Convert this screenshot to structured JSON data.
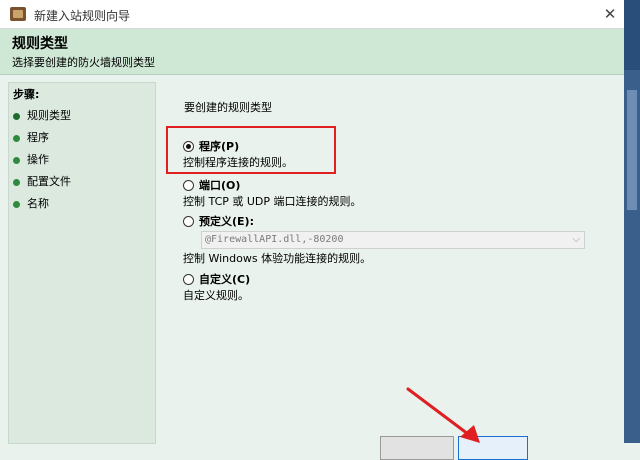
{
  "window": {
    "title": "新建入站规则向导",
    "close_glyph": "✕"
  },
  "header": {
    "title": "规则类型",
    "subtitle": "选择要创建的防火墙规则类型"
  },
  "steps": {
    "title": "步骤:",
    "items": [
      {
        "label": "规则类型",
        "current": true
      },
      {
        "label": "程序",
        "current": false
      },
      {
        "label": "操作",
        "current": false
      },
      {
        "label": "配置文件",
        "current": false
      },
      {
        "label": "名称",
        "current": false
      }
    ]
  },
  "main": {
    "lead": "要创建的规则类型",
    "options": [
      {
        "label": "程序(P)",
        "description": "控制程序连接的规则。",
        "selected": true
      },
      {
        "label": "端口(O)",
        "description": "控制 TCP 或 UDP 端口连接的规则。",
        "selected": false
      },
      {
        "label": "预定义(E):",
        "description": "控制 Windows 体验功能连接的规则。",
        "selected": false,
        "select_value": "@FirewallAPI.dll,-80200"
      },
      {
        "label": "自定义(C)",
        "description": "自定义规则。",
        "selected": false
      }
    ]
  },
  "colors": {
    "highlight": "#e02020",
    "step_dot": "#2f8a3e",
    "header_bg": "#cfe7d5"
  },
  "icons": {
    "app": "firewall-app-icon",
    "close": "close-icon",
    "dropdown": "chevron-down-icon",
    "annotation": "red-arrow-icon"
  }
}
